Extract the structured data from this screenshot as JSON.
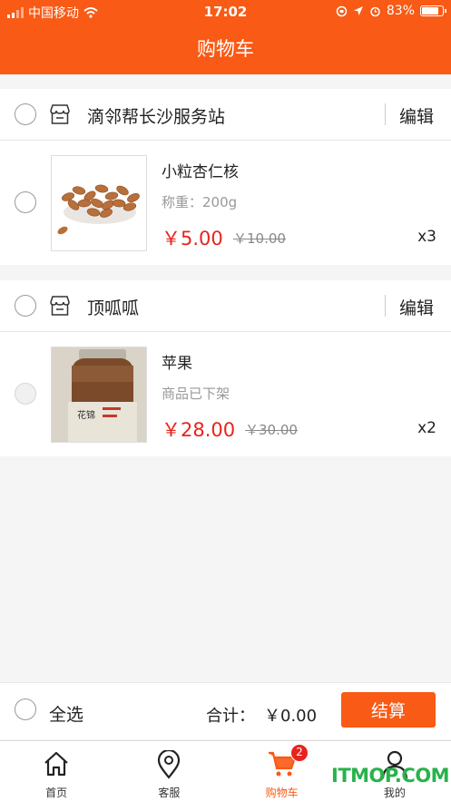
{
  "status_bar": {
    "carrier": "中国移动",
    "time": "17:02",
    "battery": "83%"
  },
  "header": {
    "title": "购物车"
  },
  "shops": [
    {
      "name": "滴邻帮长沙服务站",
      "edit_label": "编辑",
      "items": [
        {
          "name": "小粒杏仁核",
          "spec": "称重：200g",
          "price": "￥5.00",
          "original_price": "￥10.00",
          "qty": "x3"
        }
      ]
    },
    {
      "name": "顶呱呱",
      "edit_label": "编辑",
      "items": [
        {
          "name": "苹果",
          "spec": "商品已下架",
          "price": "￥28.00",
          "original_price": "￥30.00",
          "qty": "x2"
        }
      ]
    }
  ],
  "bottom_bar": {
    "select_all": "全选",
    "total_label": "合计：",
    "total_value": "￥0.00",
    "checkout_label": "结算"
  },
  "tabbar": {
    "tabs": [
      {
        "label": "首页",
        "icon": "home-icon"
      },
      {
        "label": "客服",
        "icon": "location-pin-icon"
      },
      {
        "label": "购物车",
        "icon": "cart-icon",
        "badge": "2",
        "active": true
      },
      {
        "label": "我的",
        "icon": "user-icon"
      }
    ]
  },
  "watermark": "ITMOP.COM",
  "colors": {
    "accent": "#f95a15",
    "price": "#e8231c",
    "watermark": "#28b24b"
  }
}
